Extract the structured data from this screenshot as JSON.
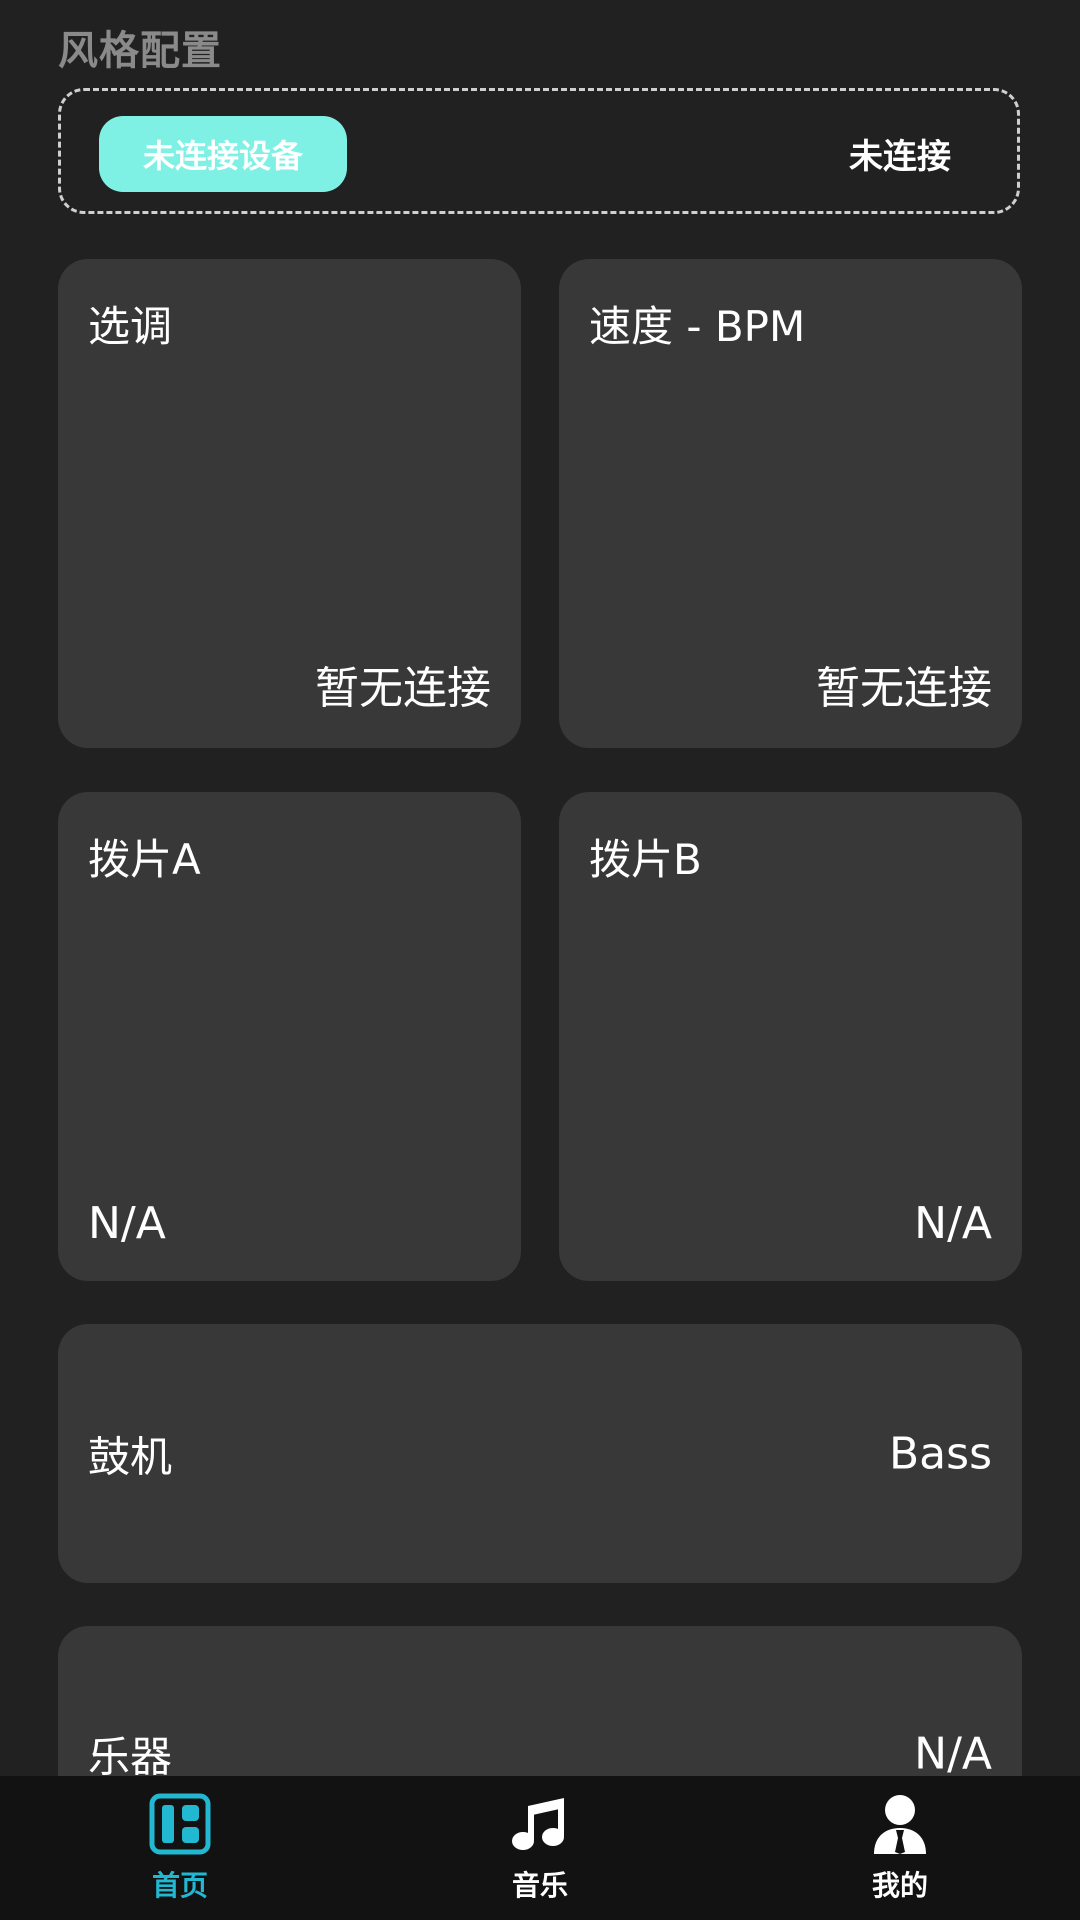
{
  "section": {
    "title": "风格配置"
  },
  "connection": {
    "button_label": "未连接设备",
    "status": "未连接"
  },
  "cards": {
    "key": {
      "title": "选调",
      "value": "暂无连接"
    },
    "tempo": {
      "title": "速度 - BPM",
      "value": "暂无连接"
    },
    "pick_a": {
      "title": "拨片A",
      "value": "N/A"
    },
    "pick_b": {
      "title": "拨片B",
      "value": "N/A"
    }
  },
  "rows": {
    "drum": {
      "label": "鼓机",
      "value": "Bass"
    },
    "instrument": {
      "label": "乐器",
      "value": "N/A"
    }
  },
  "tabbar": {
    "tabs": [
      {
        "label": "首页",
        "icon": "dashboard-icon",
        "active": true
      },
      {
        "label": "音乐",
        "icon": "music-note-icon",
        "active": false
      },
      {
        "label": "我的",
        "icon": "user-icon",
        "active": false
      }
    ]
  },
  "colors": {
    "background": "#212121",
    "card": "#383838",
    "accent": "#7ff1e4",
    "tab_active": "#23b8d2",
    "tabbar_bg": "#121212"
  }
}
